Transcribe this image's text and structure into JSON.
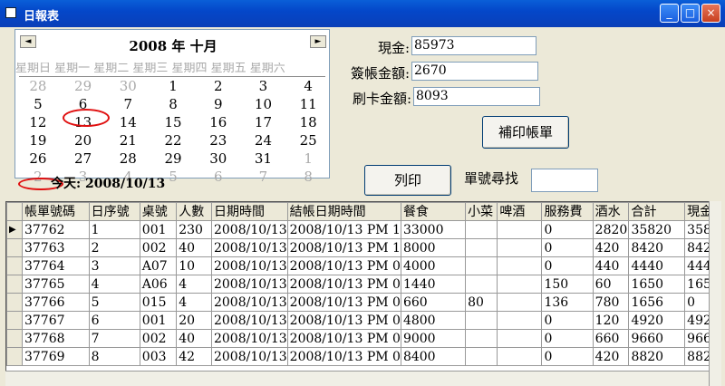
{
  "window": {
    "title": "日報表",
    "min": "_",
    "max": "□",
    "close": "×"
  },
  "calendar": {
    "month_label": "2008 年 十月",
    "prev": "◄",
    "next": "►",
    "dow": "星期日 星期一 星期二 星期三 星期四 星期五 星期六",
    "weeks": [
      [
        [
          "28",
          true
        ],
        [
          "29",
          true
        ],
        [
          "30",
          true
        ],
        [
          "1",
          false
        ],
        [
          "2",
          false
        ],
        [
          "3",
          false
        ],
        [
          "4",
          false
        ]
      ],
      [
        [
          "5",
          false
        ],
        [
          "6",
          false
        ],
        [
          "7",
          false
        ],
        [
          "8",
          false
        ],
        [
          "9",
          false
        ],
        [
          "10",
          false
        ],
        [
          "11",
          false
        ]
      ],
      [
        [
          "12",
          false
        ],
        [
          "13",
          false
        ],
        [
          "14",
          false
        ],
        [
          "15",
          false
        ],
        [
          "16",
          false
        ],
        [
          "17",
          false
        ],
        [
          "18",
          false
        ]
      ],
      [
        [
          "19",
          false
        ],
        [
          "20",
          false
        ],
        [
          "21",
          false
        ],
        [
          "22",
          false
        ],
        [
          "23",
          false
        ],
        [
          "24",
          false
        ],
        [
          "25",
          false
        ]
      ],
      [
        [
          "26",
          false
        ],
        [
          "27",
          false
        ],
        [
          "28",
          false
        ],
        [
          "29",
          false
        ],
        [
          "30",
          false
        ],
        [
          "31",
          false
        ],
        [
          "1",
          true
        ]
      ],
      [
        [
          "2",
          true
        ],
        [
          "3",
          true
        ],
        [
          "4",
          true
        ],
        [
          "5",
          true
        ],
        [
          "6",
          true
        ],
        [
          "7",
          true
        ],
        [
          "8",
          true
        ]
      ]
    ],
    "today_label": "今天: 2008/10/13"
  },
  "form": {
    "cash_label": "現金:",
    "cash_value": "85973",
    "sign_label": "簽帳金額:",
    "sign_value": "2670",
    "card_label": "刷卡金額:",
    "card_value": "8093",
    "reprint_button": "補印帳單",
    "print_button": "列印",
    "search_label": "單號尋找",
    "search_value": ""
  },
  "table": {
    "headers": [
      "帳單號碼",
      "日序號",
      "桌號",
      "人數",
      "日期時間",
      "結帳日期時間",
      "餐食",
      "小菜",
      "啤酒",
      "服務費",
      "酒水",
      "合計",
      "現金"
    ],
    "rows": [
      [
        "37762",
        "1",
        "001",
        "230",
        "2008/10/13",
        "2008/10/13 PM 1",
        "33000",
        "",
        "",
        "0",
        "2820",
        "35820",
        "358"
      ],
      [
        "37763",
        "2",
        "002",
        "40",
        "2008/10/13",
        "2008/10/13 PM 1",
        "8000",
        "",
        "",
        "0",
        "420",
        "8420",
        "842"
      ],
      [
        "37764",
        "3",
        "A07",
        "10",
        "2008/10/13",
        "2008/10/13 PM 0",
        "4000",
        "",
        "",
        "0",
        "440",
        "4440",
        "444"
      ],
      [
        "37765",
        "4",
        "A06",
        "4",
        "2008/10/13",
        "2008/10/13 PM 0",
        "1440",
        "",
        "",
        "150",
        "60",
        "1650",
        "165"
      ],
      [
        "37766",
        "5",
        "015",
        "4",
        "2008/10/13",
        "2008/10/13 PM 0",
        "660",
        "80",
        "",
        "136",
        "780",
        "1656",
        "0"
      ],
      [
        "37767",
        "6",
        "001",
        "20",
        "2008/10/13",
        "2008/10/13 PM 0",
        "4800",
        "",
        "",
        "0",
        "120",
        "4920",
        "492"
      ],
      [
        "37768",
        "7",
        "002",
        "40",
        "2008/10/13",
        "2008/10/13 PM 0",
        "9000",
        "",
        "",
        "0",
        "660",
        "9660",
        "966"
      ],
      [
        "37769",
        "8",
        "003",
        "42",
        "2008/10/13",
        "2008/10/13 PM 0",
        "8400",
        "",
        "",
        "0",
        "420",
        "8820",
        "882"
      ]
    ]
  }
}
